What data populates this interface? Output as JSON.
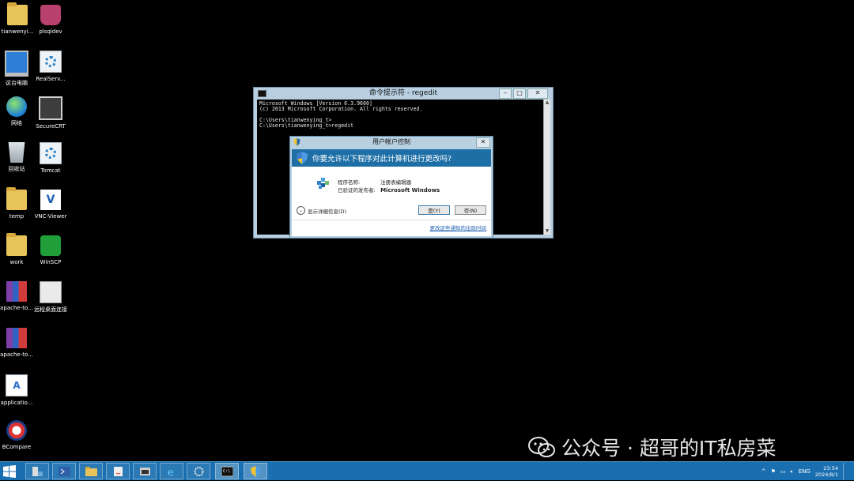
{
  "desktop": {
    "icons": [
      {
        "label": "tianwenyi..."
      },
      {
        "label": "plsqldev"
      },
      {
        "label": "这台电脑"
      },
      {
        "label": "RealServ..."
      },
      {
        "label": "网络"
      },
      {
        "label": "SecureCRT"
      },
      {
        "label": "回收站"
      },
      {
        "label": "Tomcat"
      },
      {
        "label": "temp"
      },
      {
        "label": "VNC-Viewer"
      },
      {
        "label": "work"
      },
      {
        "label": "WinSCP"
      },
      {
        "label": "apache-to..."
      },
      {
        "label": "远程桌面连接"
      },
      {
        "label": "apache-to..."
      },
      {
        "label": "applicatio..."
      },
      {
        "label": "BCompare"
      }
    ]
  },
  "cmd_window": {
    "title": "命令提示符 - regedit",
    "lines": [
      "Microsoft Windows [Version 6.3.9600]",
      "(c) 2013 Microsoft Corporation. All rights reserved.",
      "",
      "C:\\Users\\tianwenying_t>",
      "C:\\Users\\tianwenying_t>regedit"
    ]
  },
  "uac_dialog": {
    "title": "用户帐户控制",
    "question": "你要允许以下程序对此计算机进行更改吗?",
    "program_name_label": "程序名称:",
    "program_name_value": "注册表编辑器",
    "publisher_label": "已验证的发布者:",
    "publisher_value": "Microsoft Windows",
    "details_label": "显示详细信息(D)",
    "yes_label": "是(Y)",
    "no_label": "否(N)",
    "link_label": "更改这些通知的出现时间"
  },
  "watermark": {
    "text": "公众号 · 超哥的IT私房菜"
  },
  "taskbar": {
    "lang": "ENG",
    "time": "23:54",
    "date": "2024/8/1"
  },
  "colors": {
    "taskbar": "#1a6fb0",
    "uac_header": "#1d6fa6",
    "window_frame": "#b7cfe0"
  }
}
